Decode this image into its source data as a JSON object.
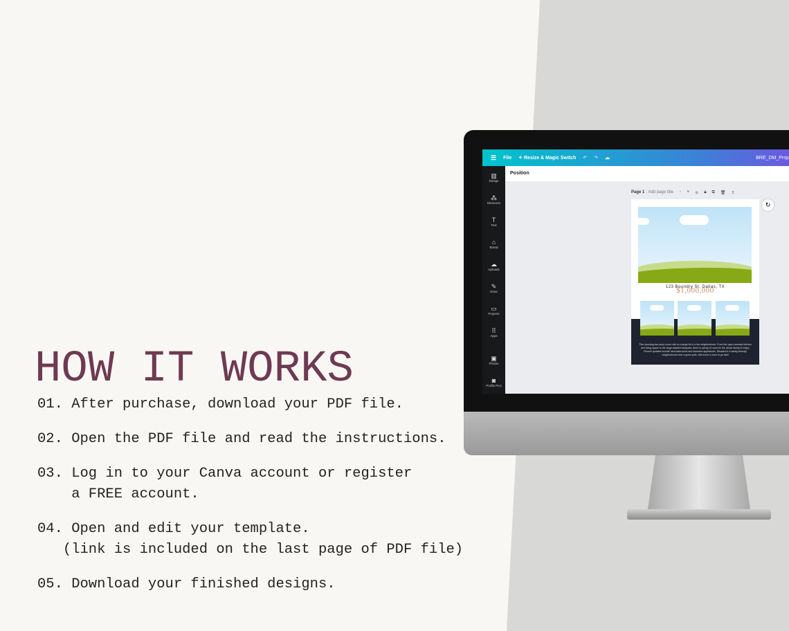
{
  "heading": "HOW IT WORKS",
  "steps": [
    "01. After purchase, download your PDF file.",
    "02. Open the PDF file and read the instructions.",
    "03. Log in to your Canva account or register\n    a FREE account.",
    "04. Open and edit your template.\n   (link is included on the last page of PDF file)",
    "05. Download your finished designs."
  ],
  "colors": {
    "heading": "#6e3a52",
    "canva_gradient_start": "#00c4cc",
    "canva_gradient_end": "#6a5ae0"
  },
  "canva": {
    "topbar": {
      "menu_icon": "hamburger-icon",
      "file": "File",
      "resize": "Resize & Magic Switch",
      "title": "BRE_DM_Prop"
    },
    "toolbar": {
      "position": "Position"
    },
    "sidebar": [
      {
        "icon": "▥",
        "label": "Design"
      },
      {
        "icon": "⁂",
        "label": "Elements"
      },
      {
        "icon": "T",
        "label": "Text"
      },
      {
        "icon": "⌂",
        "label": "Brand"
      },
      {
        "icon": "☁",
        "label": "Uploads"
      },
      {
        "icon": "✎",
        "label": "Draw"
      },
      {
        "icon": "▭",
        "label": "Projects"
      },
      {
        "icon": "⠿",
        "label": "Apps"
      },
      {
        "icon": "▣",
        "label": "Photos"
      },
      {
        "icon": "◙",
        "label": "Profile Pics"
      }
    ],
    "page": {
      "label": "Page 1",
      "add_title": "- Add page title"
    },
    "design": {
      "address": "123 Boundry St, Dallas, TX",
      "price": "$1,000,000",
      "description": "This stunning two-story home sits on a large lot in a hot neighborhood. From the open-concept kitchen and living space to the large shaded backyard, there is plenty of room for the whole family to enjoy. Recent updates include new bathrooms and stainless appliances. Situated in a family-friendly neighborhood near a great park, this home is sure to go fast!"
    }
  }
}
